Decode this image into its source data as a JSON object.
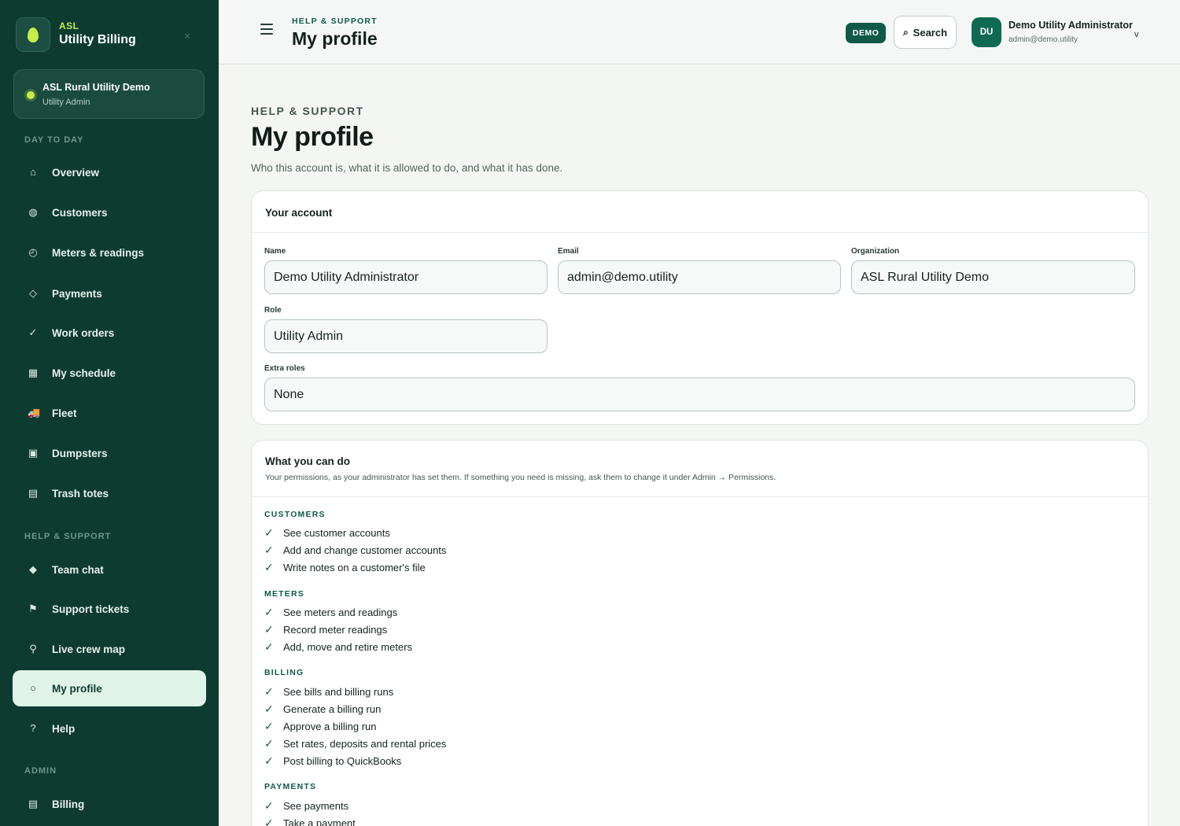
{
  "brand": {
    "small": "ASL",
    "title": "Utility Billing",
    "close_icon": "×"
  },
  "org": {
    "name": "ASL Rural Utility Demo",
    "role": "Utility Admin"
  },
  "sidebar": {
    "sections": [
      {
        "label": "DAY TO DAY"
      },
      {
        "label": "HELP & SUPPORT"
      },
      {
        "label": "ADMIN"
      }
    ],
    "items": [
      {
        "label": "Overview",
        "icon": "⌂",
        "icon_name": "home-icon"
      },
      {
        "label": "Customers",
        "icon": "◍",
        "icon_name": "customers-icon"
      },
      {
        "label": "Meters & readings",
        "icon": "◴",
        "icon_name": "gauge-icon"
      },
      {
        "label": "Payments",
        "icon": "◇",
        "icon_name": "payments-icon"
      },
      {
        "label": "Work orders",
        "icon": "✓",
        "icon_name": "check-icon"
      },
      {
        "label": "My schedule",
        "icon": "▦",
        "icon_name": "calendar-icon"
      },
      {
        "label": "Fleet",
        "icon": "🚚",
        "icon_name": "truck-icon"
      },
      {
        "label": "Dumpsters",
        "icon": "▣",
        "icon_name": "dumpster-icon"
      },
      {
        "label": "Trash totes",
        "icon": "▤",
        "icon_name": "tote-icon"
      },
      {
        "label": "Team chat",
        "icon": "◆",
        "icon_name": "chat-icon"
      },
      {
        "label": "Support tickets",
        "icon": "⚑",
        "icon_name": "flag-icon"
      },
      {
        "label": "Live crew map",
        "icon": "⚲",
        "icon_name": "map-pin-icon"
      },
      {
        "label": "My profile",
        "icon": "○",
        "icon_name": "profile-icon",
        "active": true
      },
      {
        "label": "Help",
        "icon": "?",
        "icon_name": "help-icon"
      },
      {
        "label": "Billing",
        "icon": "▤",
        "icon_name": "billing-icon"
      }
    ]
  },
  "topbar": {
    "eyebrow": "HELP & SUPPORT",
    "title": "My profile",
    "demo_badge": "DEMO",
    "search_label": "Search",
    "search_icon": "⌕",
    "user_initials": "DU",
    "user_name": "Demo Utility Administrator",
    "user_email": "admin@demo.utility",
    "chevron": "v"
  },
  "page": {
    "eyebrow": "HELP & SUPPORT",
    "title": "My profile",
    "subtitle": "Who this account is, what it is allowed to do, and what it has done."
  },
  "account": {
    "title": "Your account",
    "fields": {
      "name": {
        "label": "Name",
        "value": "Demo Utility Administrator"
      },
      "email": {
        "label": "Email",
        "value": "admin@demo.utility"
      },
      "organization": {
        "label": "Organization",
        "value": "ASL Rural Utility Demo"
      },
      "role": {
        "label": "Role",
        "value": "Utility Admin"
      },
      "extra_roles": {
        "label": "Extra roles",
        "value": "None"
      }
    }
  },
  "permissions": {
    "title": "What you can do",
    "description": "Your permissions, as your administrator has set them. If something you need is missing, ask them to change it under Admin → Permissions.",
    "tick": "✓",
    "groups": [
      {
        "title": "CUSTOMERS",
        "items": [
          "See customer accounts",
          "Add and change customer accounts",
          "Write notes on a customer's file"
        ]
      },
      {
        "title": "METERS",
        "items": [
          "See meters and readings",
          "Record meter readings",
          "Add, move and retire meters"
        ]
      },
      {
        "title": "BILLING",
        "items": [
          "See bills and billing runs",
          "Generate a billing run",
          "Approve a billing run",
          "Set rates, deposits and rental prices",
          "Post billing to QuickBooks"
        ]
      },
      {
        "title": "PAYMENTS",
        "items": [
          "See payments",
          "Take a payment"
        ]
      }
    ]
  }
}
